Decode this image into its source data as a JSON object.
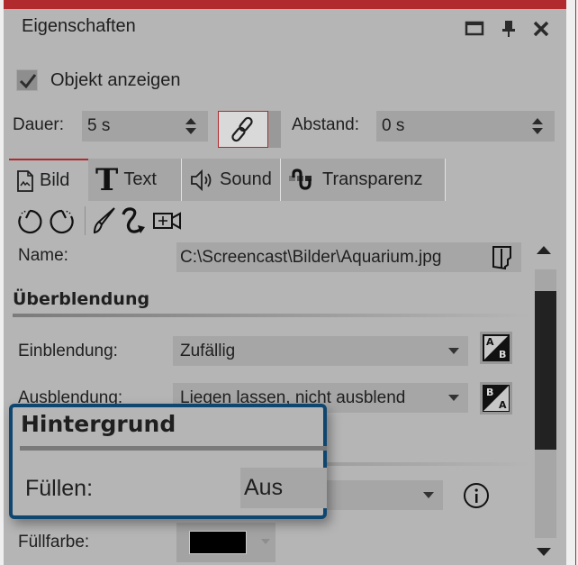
{
  "window": {
    "title": "Eigenschaften",
    "buttons": {
      "maximize": "maximize-icon",
      "pin": "pin-icon",
      "close": "close-icon"
    },
    "accent_color": "#b02a2e",
    "background": "#b5b5b5"
  },
  "show_object": {
    "label": "Objekt anzeigen",
    "checked": true
  },
  "timing": {
    "duration_label": "Dauer:",
    "duration_value": "5 s",
    "link_icon": "link-icon",
    "spacing_label": "Abstand:",
    "spacing_value": "0 s"
  },
  "tabs": [
    {
      "label": "Bild",
      "icon": "image-file-icon",
      "active": true
    },
    {
      "label": "Text",
      "icon": "text-T-icon",
      "active": false
    },
    {
      "label": "Sound",
      "icon": "speaker-icon",
      "active": false
    },
    {
      "label": "Transparenz",
      "icon": "transparency-icon",
      "active": false
    }
  ],
  "toolbar": [
    {
      "icon": "rotate-left-icon"
    },
    {
      "icon": "rotate-right-icon"
    },
    {
      "icon": "brush-icon"
    },
    {
      "icon": "curve-path-icon"
    },
    {
      "icon": "camera-pan-icon"
    }
  ],
  "name": {
    "label": "Name:",
    "value": "C:\\Screencast\\Bilder\\Aquarium.jpg",
    "browse_icon": "folder-open-icon"
  },
  "transition": {
    "title": "Überblendung",
    "fade_in_label": "Einblendung:",
    "fade_in_value": "Zufällig",
    "fade_out_label": "Ausblendung:",
    "fade_out_value": "Liegen lassen, nicht ausblend"
  },
  "background": {
    "title": "Hintergrund",
    "fill_label": "Füllen:",
    "fill_value": "Aus",
    "fill_color_label": "Füllfarbe:",
    "fill_color": "#000000",
    "callout_border": "#0f4670"
  }
}
